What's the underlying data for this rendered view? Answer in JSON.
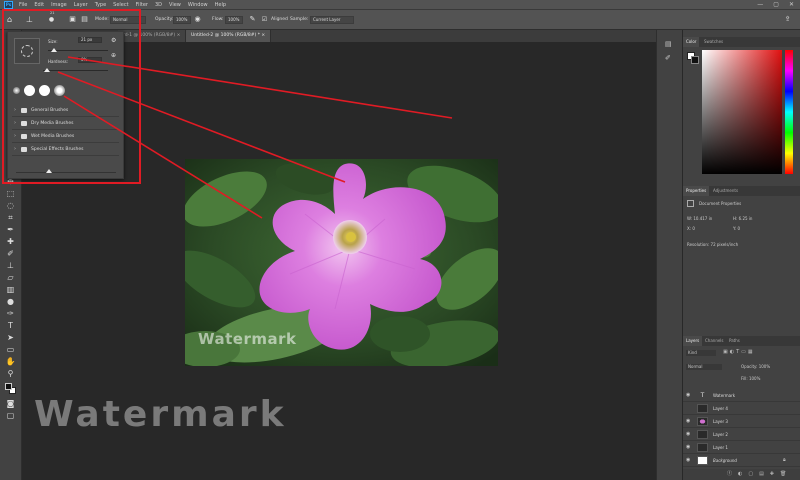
{
  "app": {
    "logo_text": "Ps"
  },
  "menu": [
    "File",
    "Edit",
    "Image",
    "Layer",
    "Type",
    "Select",
    "Filter",
    "3D",
    "View",
    "Window",
    "Help"
  ],
  "window_controls": [
    "—",
    "▢",
    "✕"
  ],
  "options_bar": {
    "brush_size_value": "21",
    "mode_label": "Mode:",
    "mode_value": "Normal",
    "opacity_label": "Opacity:",
    "opacity_value": "100%",
    "flow_label": "Flow:",
    "flow_value": "100%",
    "aligned_label": "Aligned",
    "sample_label": "Sample:",
    "sample_value": "Current Layer"
  },
  "doc_tabs": [
    {
      "label": "rd-1 @ 100% (RGB/8#) ×",
      "active": false
    },
    {
      "label": "Untitled-2 @ 100% (RGB/8#) * ×",
      "active": true
    }
  ],
  "brush_panel": {
    "size_label": "Size:",
    "size_value": "21 px",
    "hardness_label": "Hardness:",
    "hardness_value": "0%",
    "folders": [
      "General Brushes",
      "Dry Media Brushes",
      "Wet Media Brushes",
      "Special Effects Brushes"
    ]
  },
  "canvas": {
    "photo_watermark": "Watermark",
    "big_watermark": "Watermark"
  },
  "right_panels": {
    "color_tabs": [
      "Color",
      "Swatches"
    ],
    "properties_tabs": [
      "Properties",
      "Adjustments"
    ],
    "doc_properties_label": "Document Properties",
    "w_label": "W: 10.417 in",
    "h_label": "H: 6.25 in",
    "x_label": "X: 0",
    "y_label": "Y: 0",
    "resolution": "Resolution: 72 pixels/inch",
    "layers_tabs": [
      "Layers",
      "Channels",
      "Paths"
    ],
    "kind_label": "Kind",
    "blend_mode": "Normal",
    "opacity_label": "Opacity: 100%",
    "fill_label": "Fill: 100%",
    "layers": [
      {
        "name": "Watermark",
        "type": "T",
        "selected": false
      },
      {
        "name": "Layer 4",
        "type": "",
        "selected": false
      },
      {
        "name": "Layer 3",
        "type": "",
        "selected": false
      },
      {
        "name": "Layer 2",
        "type": "",
        "selected": false
      },
      {
        "name": "Layer 1",
        "type": "",
        "selected": false
      },
      {
        "name": "Background",
        "type": "",
        "selected": false
      }
    ]
  },
  "colors": {
    "annotation_red": "#e01b24",
    "accent_blue": "#31a8ff"
  },
  "icons": [
    "home-icon",
    "brush-tool-icon",
    "folder-icon",
    "eye-icon",
    "gear-icon",
    "type-layer-icon"
  ]
}
